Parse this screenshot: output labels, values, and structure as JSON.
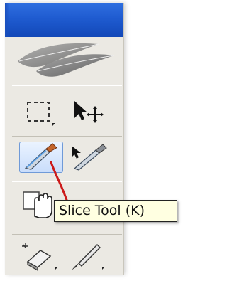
{
  "toolbar": {
    "logo_icon": "feather-logo-icon",
    "tools": [
      {
        "name": "marquee-tool",
        "icon": "dashed-rectangle-icon"
      },
      {
        "name": "move-tool",
        "icon": "arrow-move-icon"
      },
      {
        "name": "slice-tool",
        "icon": "knife-icon",
        "selected": true
      },
      {
        "name": "slice-select-tool",
        "icon": "knife-arrow-icon"
      },
      {
        "name": "hand-tool",
        "icon": "hand-icon"
      },
      {
        "name": "eraser-tool",
        "icon": "eraser-icon"
      },
      {
        "name": "brush-tool",
        "icon": "brush-icon"
      }
    ]
  },
  "tooltip": {
    "text": "Slice Tool (K)"
  },
  "colors": {
    "title_bar": "#1f5bd0",
    "panel": "#ebe9e3",
    "tooltip_bg": "#ffffe1",
    "annotation_line": "#cc1b1b"
  }
}
